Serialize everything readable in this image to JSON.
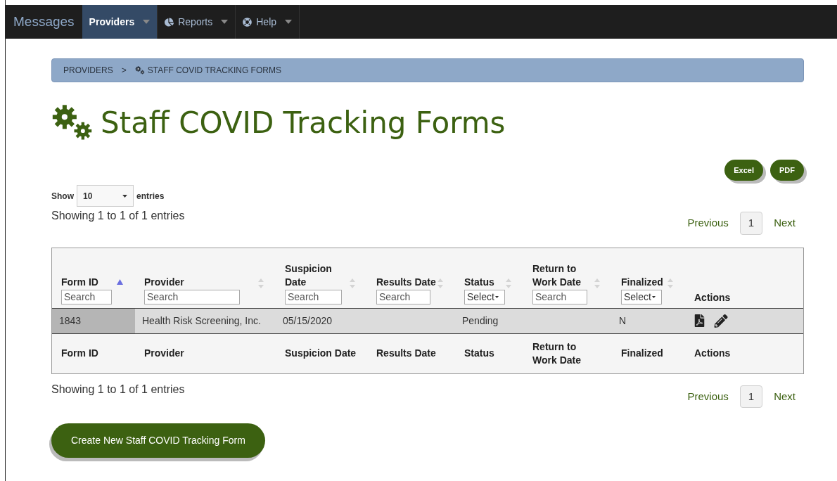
{
  "navbar": {
    "brand": "Messages",
    "items": [
      {
        "label": "Providers",
        "selected": true
      },
      {
        "label": "Reports",
        "selected": false
      },
      {
        "label": "Help",
        "selected": false
      }
    ]
  },
  "breadcrumb": {
    "items": [
      "PROVIDERS",
      "STAFF COVID TRACKING FORMS"
    ],
    "separator": ">"
  },
  "title": "Staff COVID Tracking Forms",
  "export_buttons": [
    "Excel",
    "PDF"
  ],
  "length_control": {
    "before": "Show",
    "value": "10",
    "after": "entries"
  },
  "info_top": "Showing 1 to 1 of 1 entries",
  "pagination_top": {
    "previous": "Previous",
    "pages": [
      {
        "label": "1",
        "selected": true
      }
    ],
    "next": "Next"
  },
  "table": {
    "columns": [
      {
        "label": "Form ID",
        "sortable": true,
        "sorted": true,
        "filter": {
          "kind": "search",
          "placeholder": "Search"
        }
      },
      {
        "label": "Provider",
        "sortable": true,
        "sorted": false,
        "filter": {
          "kind": "search",
          "placeholder": "Search"
        }
      },
      {
        "label": "Suspicion Date",
        "sortable": true,
        "sorted": false,
        "filter": {
          "kind": "search",
          "placeholder": "Search"
        }
      },
      {
        "label": "Results Date",
        "sortable": true,
        "sorted": false,
        "filter": {
          "kind": "search",
          "placeholder": "Search"
        }
      },
      {
        "label": "Status",
        "sortable": true,
        "sorted": false,
        "filter": {
          "kind": "select",
          "value": "Select"
        }
      },
      {
        "label": "Return to Work Date",
        "sortable": true,
        "sorted": false,
        "filter": {
          "kind": "search",
          "placeholder": "Search"
        }
      },
      {
        "label": "Finalized",
        "sortable": true,
        "sorted": false,
        "filter": {
          "kind": "select",
          "value": "Select"
        }
      },
      {
        "label": "Actions",
        "sortable": false,
        "sorted": false,
        "filter": {
          "kind": "none"
        }
      }
    ],
    "rows": [
      {
        "cells": [
          "1843",
          "Health Risk Screening, Inc.",
          "05/15/2020",
          null,
          "Pending",
          null,
          "N"
        ]
      }
    ],
    "footer": [
      "Form ID",
      "Provider",
      "Suspicion Date",
      "Results Date",
      "Status",
      "Return to Work Date",
      "Finalized",
      "Actions"
    ]
  },
  "info_bottom": "Showing 1 to 1 of 1 entries",
  "pagination_bottom": {
    "previous": "Previous",
    "pages": [
      {
        "label": "1",
        "selected": true
      }
    ],
    "next": "Next"
  },
  "create_button": "Create New Staff COVID Tracking Form"
}
